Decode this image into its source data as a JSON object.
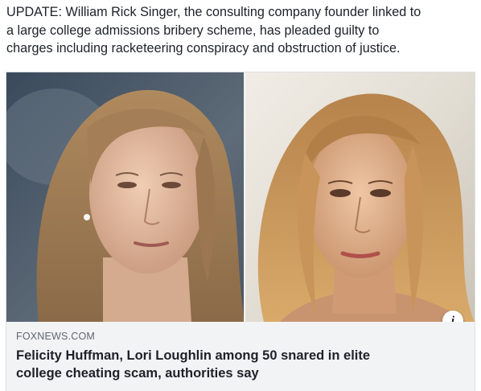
{
  "post": {
    "text_lines": [
      "UPDATE: William Rick Singer, the consulting company founder linked to",
      "a large college admissions bribery scheme, has pleaded guilty to",
      "charges including racketeering conspiracy and obstruction of justice."
    ]
  },
  "link_card": {
    "domain": "FOXNEWS.COM",
    "headline_lines": [
      "Felicity Huffman, Lori Loughlin among 50 snared in elite",
      "college cheating scam, authorities say"
    ],
    "info_icon": "info-icon",
    "info_glyph": "i"
  },
  "colors": {
    "text": "#1d2129",
    "secondary_text": "#606770",
    "footer_bg": "#f2f3f5",
    "border": "#dddfe2"
  }
}
